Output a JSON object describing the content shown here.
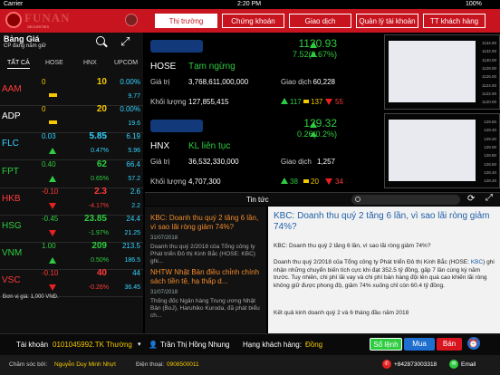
{
  "status_bar": {
    "carrier": "Carrier",
    "time": "2:20 PM",
    "battery": "100%"
  },
  "brand": {
    "name": "FUNAN",
    "subtitle": "SECURITIES"
  },
  "nav_tabs": [
    {
      "label": "Thị trường",
      "active": true
    },
    {
      "label": "Chứng khoán",
      "active": false
    },
    {
      "label": "Giao dịch",
      "active": false
    },
    {
      "label": "Quản lý tài khoản",
      "active": false
    },
    {
      "label": "TT khách hàng",
      "active": false
    }
  ],
  "price_board": {
    "title": "Bảng Giá",
    "subtitle": "CP đang nắm giữ",
    "tabs": [
      "TẤT CẢ",
      "HOSE",
      "HNX",
      "UPCOM"
    ],
    "rows": [
      {
        "symbol": "AAM",
        "change": "0",
        "change_pct": "",
        "price": "10",
        "value": "0.00%",
        "volume": "9.77",
        "color": "yellow",
        "symbol_color": "red",
        "mark": "bar"
      },
      {
        "symbol": "ADP",
        "change": "0",
        "change_pct": "",
        "price": "20",
        "value": "0.00%",
        "volume": "19.6",
        "color": "yellow",
        "symbol_color": "white",
        "mark": "bar"
      },
      {
        "symbol": "FLC",
        "change": "0.03",
        "change_pct": "0.47%",
        "price": "5.85",
        "value": "6.19",
        "volume": "5.96",
        "color": "cyan",
        "symbol_color": "cyan",
        "mark": "up"
      },
      {
        "symbol": "FPT",
        "change": "0.40",
        "change_pct": "0.65%",
        "price": "62",
        "value": "66.4",
        "volume": "57.2",
        "color": "green",
        "symbol_color": "green",
        "mark": "up"
      },
      {
        "symbol": "HKB",
        "change": "-0.10",
        "change_pct": "-4.17%",
        "price": "2.3",
        "value": "2.6",
        "volume": "2.2",
        "color": "red",
        "symbol_color": "red",
        "mark": "down"
      },
      {
        "symbol": "HSG",
        "change": "-0.45",
        "change_pct": "-1.97%",
        "price": "23.85",
        "value": "24.4",
        "volume": "21.25",
        "color": "green",
        "symbol_color": "green",
        "mark": "down"
      },
      {
        "symbol": "VNM",
        "change": "1.00",
        "change_pct": "0.50%",
        "price": "209",
        "value": "213.5",
        "volume": "186.5",
        "color": "green",
        "symbol_color": "green",
        "mark": "up"
      },
      {
        "symbol": "VSC",
        "change": "-0.10",
        "change_pct": "-0.26%",
        "price": "40",
        "value": "44",
        "volume": "36.45",
        "color": "red",
        "symbol_color": "red",
        "mark": "down"
      }
    ],
    "unit_note": "Đơn vị giá: 1,000 VNĐ."
  },
  "markets": [
    {
      "name": "HOSE",
      "status": "Tạm ngừng",
      "button": "VN-Index",
      "index": "1130.93",
      "change": "7.52(0.67%)",
      "value_label": "Giá trị",
      "value": "3,768,611,000,000",
      "volume_label": "Khối lượng",
      "volume": "127,855,415",
      "trades_label": "Giao dịch",
      "trades": "60,228",
      "up": "117",
      "flat": "137",
      "down": "55"
    },
    {
      "name": "HNX",
      "status": "KL liên tục",
      "button": "HNX-Index",
      "index": "129.32",
      "change": "0.26(0.2%)",
      "value_label": "Giá trị",
      "value": "36,532,330,000",
      "volume_label": "Khối lượng",
      "volume": "4,707,300",
      "trades_label": "Giao dịch",
      "trades": "1,257",
      "up": "38",
      "flat": "20",
      "down": "34"
    }
  ],
  "mini_charts": [
    {
      "ticks": [
        "1134.00",
        "1132.00",
        "1130.00",
        "1128.00",
        "1126.00",
        "1124.00",
        "1122.00",
        "1120.00"
      ],
      "color": "#e8eaf0"
    },
    {
      "ticks": [
        "129.60",
        "129.40",
        "129.20",
        "129.00",
        "128.80",
        "128.60",
        "128.40",
        "128.20"
      ],
      "color": "#e8eaf0"
    }
  ],
  "news": {
    "header": "Tin tức",
    "search_placeholder": "",
    "items": [
      {
        "title": "KBC: Doanh thu quý 2 tăng 6 lần, vì sao lãi ròng giảm 74%?",
        "date": "31/07/2018",
        "summary": "Doanh thu quý 2/2018 của Tổng công ty Phát triển Đô thị Kinh Bắc (HOSE: KBC) ghi..."
      },
      {
        "title": "NHTW Nhật Bản điều chỉnh chính sách tiền tệ, hạ thấp d...",
        "date": "31/07/2018",
        "summary": "Thống đốc Ngân hàng Trung ương Nhật Bản (BoJ), Haruhiko Kuroda, đã phát biểu ch..."
      }
    ],
    "detail": {
      "title": "KBC: Doanh thu quý 2 tăng 6 lần, vì sao lãi ròng giảm 74%?",
      "lead": "KBC: Doanh thu quý 2 tăng 6 lần, vì sao lãi ròng giảm 74%?",
      "body_1": "Doanh thu quý 2/2018 của Tổng công ty Phát triển Đô thị Kinh Bắc (HOSE:",
      "body_link": "KBC",
      "body_2": ") ghi nhận những chuyển biến tích cực khi đạt 352.5 tỷ đồng, gấp 7 lần cùng kỳ năm trước. Tuy nhiên, chi phí lãi vay và chi phí bán hàng đội lên quá cao khiến lãi ròng không giữ được phong độ, giảm 74% xuống chỉ còn 60.4 tỷ đồng.",
      "footer": "Kết quả kinh doanh quý 2 và 6 tháng đầu năm 2018"
    }
  },
  "account": {
    "label": "Tài khoản",
    "number": "0101045992.TK Thường",
    "owner": "Trần Thị Hồng Nhung",
    "tier_label": "Hạng khách hàng:",
    "tier": "Đồng",
    "order_book": "Sổ lệnh",
    "buy": "Mua",
    "sell": "Bán"
  },
  "footer": {
    "care_label": "Chăm sóc bởi:",
    "care_name": "Nguyễn Duy Minh Nhựt",
    "phone_label": "Điện thoại:",
    "phone": "0908500011",
    "hotline": "+842873003318",
    "email": "Email"
  },
  "colors": {
    "brand_red": "#c8141e",
    "up_green": "#2ecc40",
    "down_red": "#ff3b3b",
    "ref_yellow": "#f5c800",
    "ceiling_cyan": "#32d4ff",
    "news_orange": "#f08a2a"
  }
}
